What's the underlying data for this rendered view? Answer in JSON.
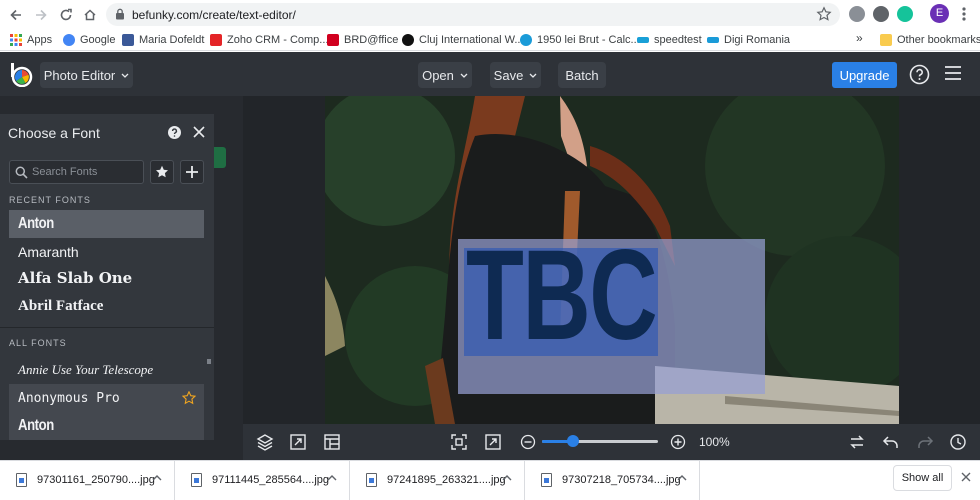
{
  "browser": {
    "url": "befunky.com/create/text-editor/",
    "profile_initial": "E",
    "bookmarks": [
      {
        "label": "Apps",
        "color": "#e8453c"
      },
      {
        "label": "Google",
        "color": "#4285f4"
      },
      {
        "label": "Maria Dofeldt",
        "color": "#3b5998"
      },
      {
        "label": "Zoho CRM - Comp...",
        "color": "#e42527"
      },
      {
        "label": "BRD@ffice",
        "color": "#d1001f"
      },
      {
        "label": "Cluj International W...",
        "color": "#111111"
      },
      {
        "label": "1950 lei Brut - Calc...",
        "color": "#1a9bd8"
      },
      {
        "label": "speedtest",
        "color": "#19a0d7"
      },
      {
        "label": "Digi Romania",
        "color": "#1a9bd8"
      }
    ],
    "bookmarks_more": "»",
    "other_bookmarks": "Other bookmarks"
  },
  "app": {
    "product_menu": "Photo Editor",
    "open_label": "Open",
    "save_label": "Save",
    "batch_label": "Batch",
    "upgrade_label": "Upgrade",
    "accent_color": "#2a80e6"
  },
  "font_panel": {
    "title": "Choose a Font",
    "search_placeholder": "Search Fonts",
    "recent_label": "RECENT FONTS",
    "recent_fonts": [
      "Anton",
      "Amaranth",
      "Alfa Slab One",
      "Abril Fatface"
    ],
    "all_label": "ALL FONTS",
    "all_fonts": [
      "Annie Use Your Telescope",
      "Anonymous Pro",
      "Anton"
    ],
    "selected_font": "Anton"
  },
  "canvas": {
    "text": "TBC"
  },
  "toolbar": {
    "zoom_value": "100%",
    "zoom_slider_fraction": 0.27
  },
  "downloads": {
    "items": [
      "97301161_250790....jpg",
      "97111445_285564....jpg",
      "97241895_263321....jpg",
      "97307218_705734....jpg"
    ],
    "show_all": "Show all"
  }
}
